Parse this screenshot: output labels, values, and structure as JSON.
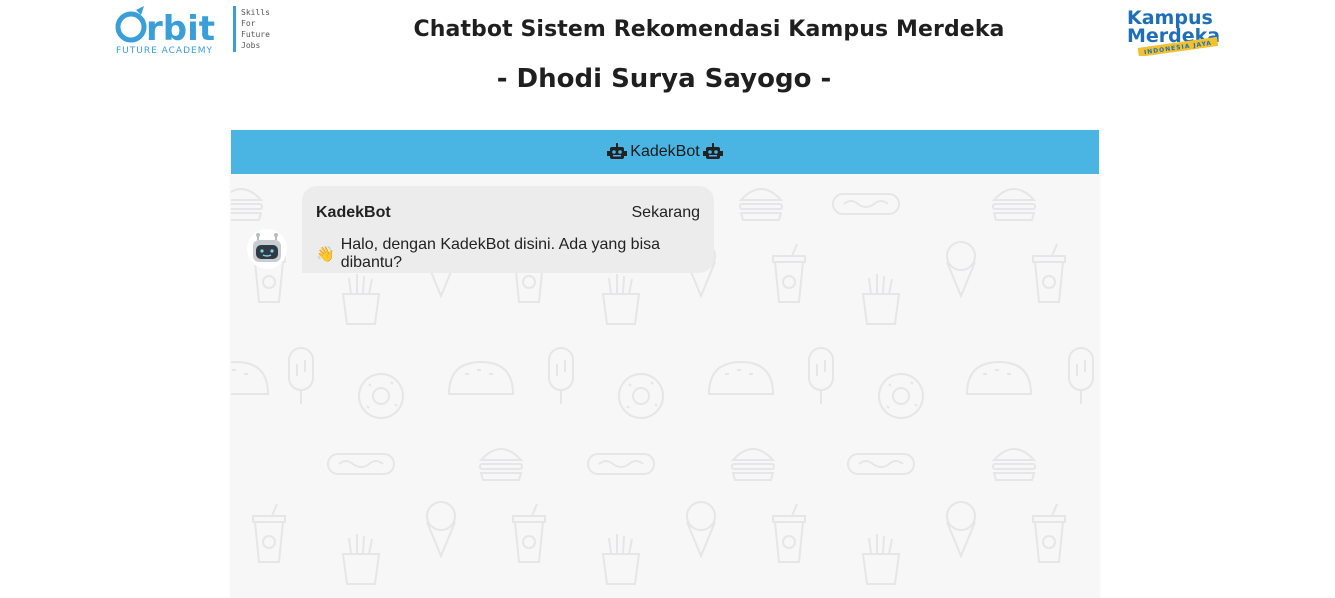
{
  "header": {
    "title": "Chatbot Sistem Rekomendasi Kampus Merdeka",
    "subtitle": "- Dhodi Surya Sayogo -",
    "logo_left": {
      "brand": "orbit",
      "tagline": "FUTURE ACADEMY",
      "motto": [
        "Skills",
        "For",
        "Future",
        "Jobs"
      ]
    },
    "logo_right": {
      "line1": "Kampus",
      "line2": "Merdeka",
      "ribbon": "INDONESIA JAYA"
    }
  },
  "chat": {
    "bot_name": "KadekBot",
    "header_icon": "robot-icon",
    "messages": [
      {
        "sender": "KadekBot",
        "time": "Sekarang",
        "icon": "waving-hand-icon",
        "text": "Halo, dengan KadekBot disini. Ada yang bisa dibantu?"
      }
    ]
  },
  "colors": {
    "chat_header": "#4ab5e3",
    "bubble": "#ececec",
    "chat_bg": "#f7f7f8",
    "orbit_blue": "#3a9fd8",
    "km_blue": "#1e6fb8",
    "km_yellow": "#f2c12e"
  }
}
